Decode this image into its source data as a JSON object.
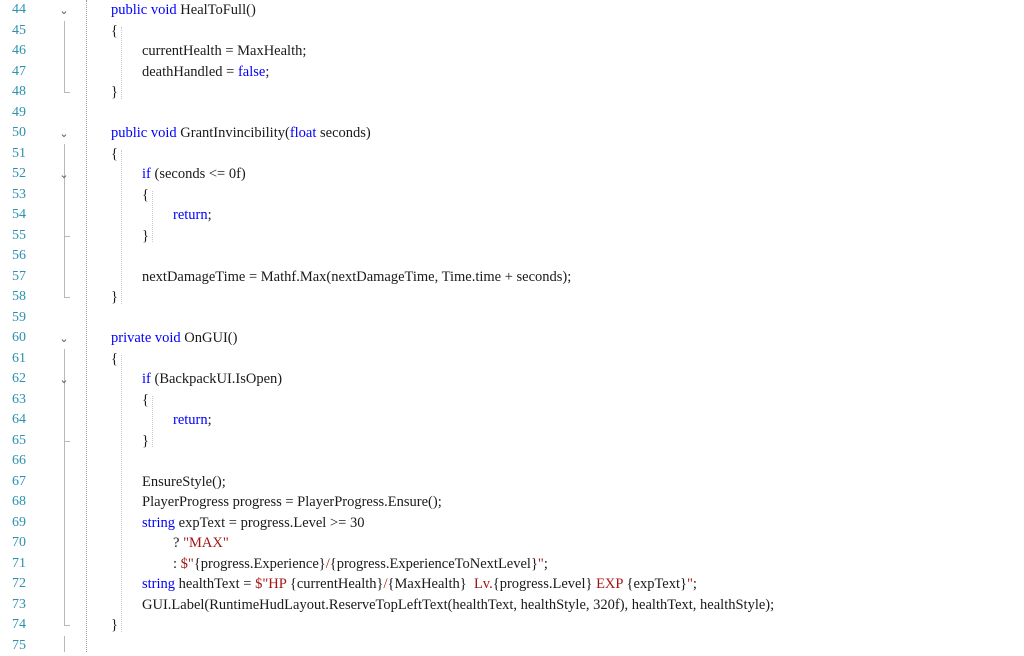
{
  "editor": {
    "lines": [
      {
        "n": "44",
        "fold": true,
        "i": 0,
        "t": [
          [
            "kw",
            "public void "
          ],
          [
            "plain",
            "HealToFull()"
          ]
        ]
      },
      {
        "n": "45",
        "i": 0,
        "t": [
          [
            "plain",
            "{"
          ]
        ]
      },
      {
        "n": "46",
        "i": 1,
        "t": [
          [
            "plain",
            "currentHealth = MaxHealth;"
          ]
        ]
      },
      {
        "n": "47",
        "i": 1,
        "t": [
          [
            "plain",
            "deathHandled = "
          ],
          [
            "kw",
            "false"
          ],
          [
            "plain",
            ";"
          ]
        ]
      },
      {
        "n": "48",
        "i": 0,
        "t": [
          [
            "plain",
            "}"
          ]
        ]
      },
      {
        "n": "49",
        "i": 0,
        "t": []
      },
      {
        "n": "50",
        "fold": true,
        "i": 0,
        "t": [
          [
            "kw",
            "public void "
          ],
          [
            "plain",
            "GrantInvincibility("
          ],
          [
            "kw",
            "float "
          ],
          [
            "plain",
            "seconds)"
          ]
        ]
      },
      {
        "n": "51",
        "i": 0,
        "t": [
          [
            "plain",
            "{"
          ]
        ]
      },
      {
        "n": "52",
        "fold": true,
        "i": 1,
        "t": [
          [
            "kw",
            "if "
          ],
          [
            "plain",
            "(seconds <= 0f)"
          ]
        ]
      },
      {
        "n": "53",
        "i": 1,
        "t": [
          [
            "plain",
            "{"
          ]
        ]
      },
      {
        "n": "54",
        "i": 2,
        "t": [
          [
            "kw",
            "return"
          ],
          [
            "plain",
            ";"
          ]
        ]
      },
      {
        "n": "55",
        "i": 1,
        "t": [
          [
            "plain",
            "}"
          ]
        ]
      },
      {
        "n": "56",
        "i": 0,
        "t": []
      },
      {
        "n": "57",
        "i": 1,
        "t": [
          [
            "plain",
            "nextDamageTime = Mathf.Max(nextDamageTime, Time.time + seconds);"
          ]
        ]
      },
      {
        "n": "58",
        "i": 0,
        "t": [
          [
            "plain",
            "}"
          ]
        ]
      },
      {
        "n": "59",
        "i": 0,
        "t": []
      },
      {
        "n": "60",
        "fold": true,
        "i": 0,
        "t": [
          [
            "kw",
            "private void "
          ],
          [
            "plain",
            "OnGUI()"
          ]
        ]
      },
      {
        "n": "61",
        "i": 0,
        "t": [
          [
            "plain",
            "{"
          ]
        ]
      },
      {
        "n": "62",
        "fold": true,
        "i": 1,
        "t": [
          [
            "kw",
            "if "
          ],
          [
            "plain",
            "(BackpackUI.IsOpen)"
          ]
        ]
      },
      {
        "n": "63",
        "i": 1,
        "t": [
          [
            "plain",
            "{"
          ]
        ]
      },
      {
        "n": "64",
        "i": 2,
        "t": [
          [
            "kw",
            "return"
          ],
          [
            "plain",
            ";"
          ]
        ]
      },
      {
        "n": "65",
        "i": 1,
        "t": [
          [
            "plain",
            "}"
          ]
        ]
      },
      {
        "n": "66",
        "i": 0,
        "t": []
      },
      {
        "n": "67",
        "i": 1,
        "t": [
          [
            "plain",
            "EnsureStyle();"
          ]
        ]
      },
      {
        "n": "68",
        "i": 1,
        "t": [
          [
            "plain",
            "PlayerProgress progress = PlayerProgress.Ensure();"
          ]
        ]
      },
      {
        "n": "69",
        "i": 1,
        "t": [
          [
            "kw",
            "string "
          ],
          [
            "plain",
            "expText = progress.Level >= 30"
          ]
        ]
      },
      {
        "n": "70",
        "i": 2,
        "t": [
          [
            "plain",
            "? "
          ],
          [
            "str",
            "\"MAX\""
          ]
        ]
      },
      {
        "n": "71",
        "i": 2,
        "t": [
          [
            "plain",
            ": "
          ],
          [
            "str",
            "$\""
          ],
          [
            "plain",
            "{progress.Experience}"
          ],
          [
            "str",
            "/"
          ],
          [
            "plain",
            "{progress.ExperienceToNextLevel}"
          ],
          [
            "str",
            "\""
          ],
          [
            "plain",
            ";"
          ]
        ]
      },
      {
        "n": "72",
        "i": 1,
        "t": [
          [
            "kw",
            "string "
          ],
          [
            "plain",
            "healthText = "
          ],
          [
            "str",
            "$\"HP "
          ],
          [
            "plain",
            "{currentHealth}"
          ],
          [
            "str",
            "/"
          ],
          [
            "plain",
            "{MaxHealth}"
          ],
          [
            "str",
            "  Lv."
          ],
          [
            "plain",
            "{progress.Level}"
          ],
          [
            "str",
            " EXP "
          ],
          [
            "plain",
            "{expText}"
          ],
          [
            "str",
            "\""
          ],
          [
            "plain",
            ";"
          ]
        ]
      },
      {
        "n": "73",
        "i": 1,
        "t": [
          [
            "plain",
            "GUI.Label(RuntimeHudLayout.ReserveTopLeftText(healthText, healthStyle, 320f), healthText, healthStyle);"
          ]
        ]
      },
      {
        "n": "74",
        "i": 0,
        "t": [
          [
            "plain",
            "}"
          ]
        ]
      },
      {
        "n": "75",
        "i": 0,
        "t": []
      }
    ]
  },
  "icons": {
    "fold": "chevron-down-icon",
    "fold_glyph": "⌄"
  }
}
